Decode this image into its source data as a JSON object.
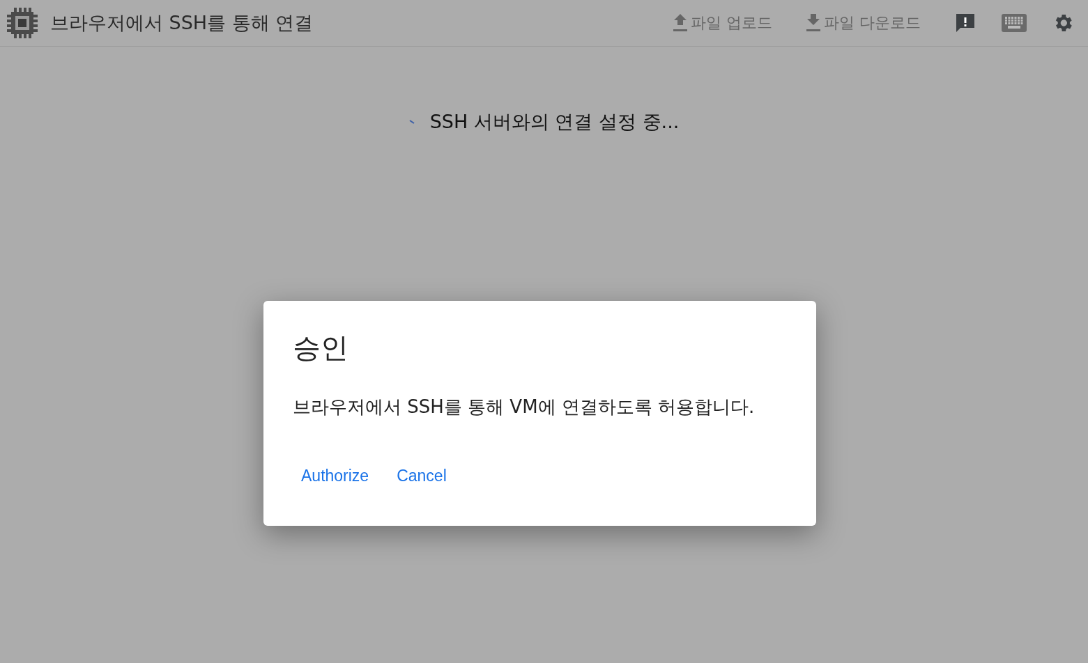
{
  "header": {
    "title": "브라우저에서 SSH를 통해 연결",
    "actions": [
      {
        "label": "파일 업로드",
        "kind": "upload",
        "disabled": true
      },
      {
        "label": "파일 다운로드",
        "kind": "download",
        "disabled": true
      }
    ]
  },
  "status": {
    "message": "SSH 서버와의 연결 설정 중..."
  },
  "dialog": {
    "title": "승인",
    "message": "브라우저에서 SSH를 통해 VM에 연결하도록 허용합니다.",
    "buttons": [
      "Authorize",
      "Cancel"
    ]
  }
}
